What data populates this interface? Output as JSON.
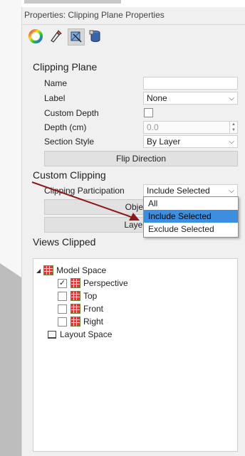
{
  "panel": {
    "title": "Properties: Clipping Plane Properties"
  },
  "tabs": [
    {
      "icon": "color-wheel-icon"
    },
    {
      "icon": "material-icon"
    },
    {
      "icon": "clipping-plane-icon"
    },
    {
      "icon": "database-icon"
    }
  ],
  "clipping_plane": {
    "heading": "Clipping Plane",
    "name_label": "Name",
    "name_value": "",
    "label_label": "Label",
    "label_value": "None",
    "custom_depth_label": "Custom Depth",
    "custom_depth_checked": false,
    "depth_label": "Depth (cm)",
    "depth_value": "0.0",
    "section_style_label": "Section Style",
    "section_style_value": "By Layer",
    "flip_button": "Flip Direction"
  },
  "custom_clipping": {
    "heading": "Custom Clipping",
    "participation_label": "Clipping Participation",
    "participation_value": "Include Selected",
    "objects_button": "Objects",
    "layers_button": "Layers (",
    "options": [
      "All",
      "Include Selected",
      "Exclude Selected"
    ],
    "selected_option": "Include Selected"
  },
  "views_clipped": {
    "heading": "Views Clipped",
    "model_space": "Model Space",
    "views": [
      {
        "label": "Perspective",
        "checked": true
      },
      {
        "label": "Top",
        "checked": false
      },
      {
        "label": "Front",
        "checked": false
      },
      {
        "label": "Right",
        "checked": false
      }
    ],
    "layout_space": "Layout Space"
  },
  "colors": {
    "accent": "#3b8ee0",
    "arrow": "#8b1a1a"
  }
}
